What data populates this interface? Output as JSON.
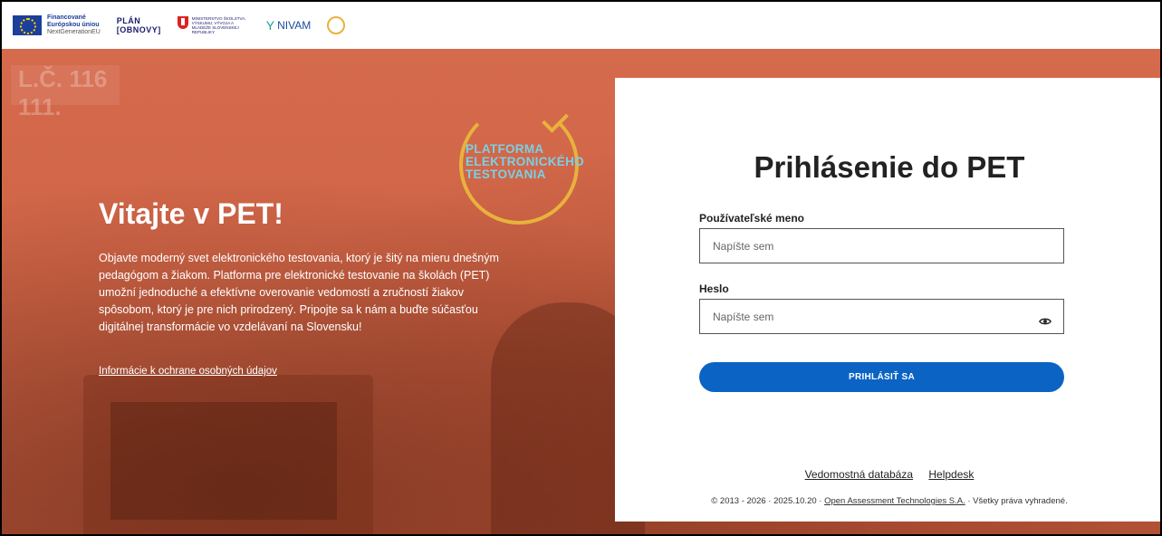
{
  "logos": {
    "eu": {
      "line1": "Financované",
      "line2": "Európskou úniou",
      "line3": "NextGenerationEU"
    },
    "plan": {
      "line1": "PLÁN",
      "line2": "[OBNOVY]"
    },
    "ministry": {
      "text": "MINISTERSTVO ŠKOLSTVA, VÝSKUMU, VÝVOJA A MLÁDEŽE SLOVENSKEJ REPUBLIKY"
    },
    "nivam": {
      "text": "NIVAM"
    }
  },
  "hero": {
    "board_text": "L.Č. 116 111.",
    "platform_line1": "PLATFORMA",
    "platform_line2": "ELEKTRONICKÉHO",
    "platform_line3": "TESTOVANIA",
    "title": "Vitajte v PET!",
    "description": "Objavte moderný svet elektronického testovania, ktorý je šitý na mieru dnešným pedagógom a žiakom. Platforma pre elektronické testovanie na školách (PET) umožní jednoduché a efektívne overovanie vedomostí a zručností žiakov spôsobom, ktorý je pre nich prirodzený. Pripojte sa k nám a buďte súčasťou digitálnej transformácie vo vzdelávaní na Slovensku!",
    "privacy_link": "Informácie k ochrane osobných údajov"
  },
  "login": {
    "title": "Prihlásenie do PET",
    "username_label": "Používateľské meno",
    "username_placeholder": "Napíšte sem",
    "username_value": "",
    "password_label": "Heslo",
    "password_placeholder": "Napíšte sem",
    "password_value": "",
    "submit_label": "PRIHLÁSIŤ SA"
  },
  "footer": {
    "link_knowledge": "Vedomostná databáza",
    "link_helpdesk": "Helpdesk",
    "copyright_prefix": "© 2013 - 2026 · 2025.10.20 ·",
    "copyright_link": "Open Assessment Technologies S.A.",
    "copyright_suffix": "· Všetky práva vyhradené."
  },
  "colors": {
    "hero_bg": "#d56a4c",
    "primary_button": "#0b63c4",
    "platform_ring": "#e8b23c",
    "platform_text": "#7ad0e6"
  },
  "icons": {
    "password_toggle": "eye-icon"
  }
}
